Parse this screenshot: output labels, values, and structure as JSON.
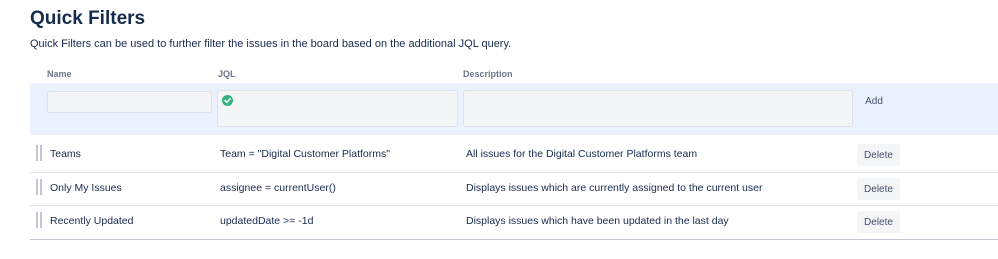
{
  "page": {
    "title": "Quick Filters",
    "description": "Quick Filters can be used to further filter the issues in the board based on the additional JQL query."
  },
  "columns": {
    "name": "Name",
    "jql": "JQL",
    "description": "Description"
  },
  "create_form": {
    "name_value": "",
    "jql_value": "",
    "jql_status": "valid",
    "description_value": "",
    "add_label": "Add"
  },
  "filters": [
    {
      "name": "Teams",
      "jql": "Team = \"Digital Customer Platforms\"",
      "description": "All issues for the Digital Customer Platforms team",
      "delete_label": "Delete"
    },
    {
      "name": "Only My Issues",
      "jql": "assignee = currentUser()",
      "description": "Displays issues which are currently assigned to the current user",
      "delete_label": "Delete"
    },
    {
      "name": "Recently Updated",
      "jql": "updatedDate >= -1d",
      "description": "Displays issues which have been updated in the last day",
      "delete_label": "Delete"
    }
  ],
  "icons": {
    "valid": "check-circle-icon",
    "drag": "drag-handle-icon"
  },
  "colors": {
    "create_row_bg": "#ebf2ff",
    "valid_green": "#36b37e",
    "text": "#172b4d"
  }
}
